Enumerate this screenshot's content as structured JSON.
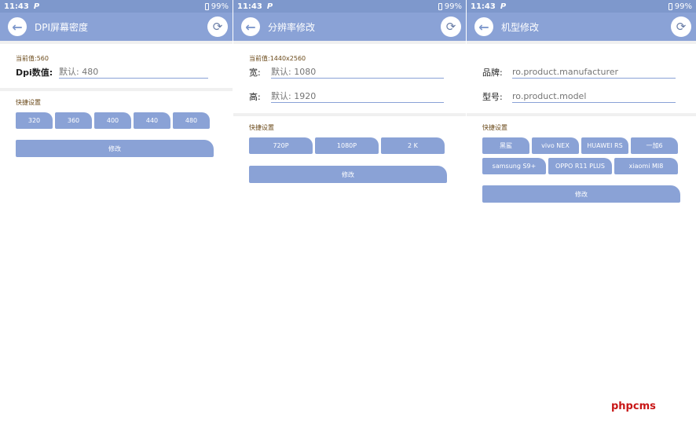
{
  "status": {
    "time": "11:43",
    "carrier": "P",
    "battery": "99%"
  },
  "p1": {
    "title": "DPI屏幕密度",
    "current": "当前值:560",
    "dpi_label": "Dpi数值:",
    "dpi_placeholder": "默认: 480",
    "quick": "快捷设置",
    "presets": [
      "320",
      "360",
      "400",
      "440",
      "480"
    ],
    "modify": "修改"
  },
  "p2": {
    "title": "分辨率修改",
    "current": "当前值:1440x2560",
    "width_label": "宽:",
    "width_placeholder": "默认: 1080",
    "height_label": "高:",
    "height_placeholder": "默认: 1920",
    "quick": "快捷设置",
    "presets": [
      "720P",
      "1080P",
      "2 K"
    ],
    "modify": "修改"
  },
  "p3": {
    "title": "机型修改",
    "brand_label": "品牌:",
    "brand_placeholder": "ro.product.manufacturer",
    "model_label": "型号:",
    "model_placeholder": "ro.product.model",
    "quick": "快捷设置",
    "presets_row1": [
      "黑鲨",
      "vivo NEX",
      "HUAWEI RS",
      "一加6"
    ],
    "presets_row2": [
      "samsung S9+",
      "OPPO R11 PLUS",
      "xiaomi MI8"
    ],
    "modify": "修改"
  },
  "watermark": "phpcms",
  "icons": {
    "back": "back-arrow-icon",
    "settings": "settings-icon"
  }
}
